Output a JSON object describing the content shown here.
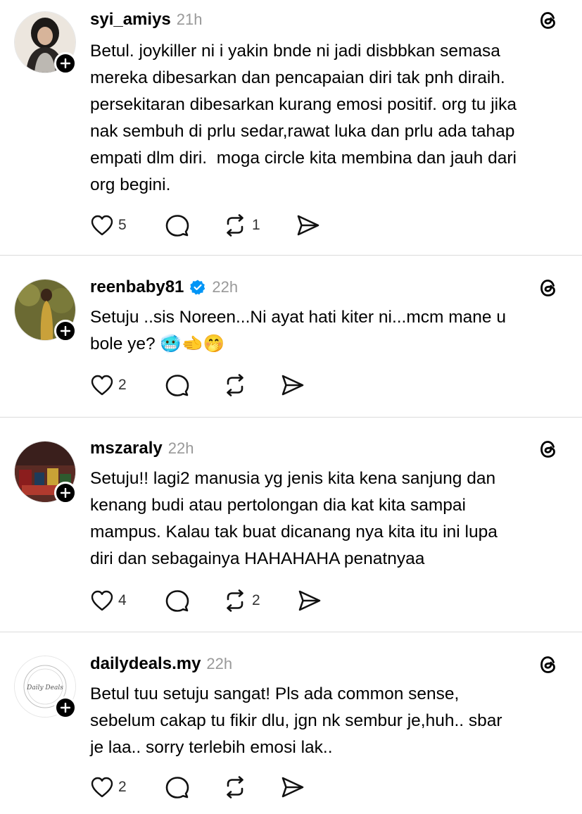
{
  "posts": [
    {
      "username": "syi_amiys",
      "time": "21h",
      "verified": false,
      "text": "Betul. joykiller ni i yakin bnde ni jadi disbbkan semasa\nmereka dibesarkan dan pencapaian diri tak pnh diraih.\npersekitaran dibesarkan kurang emosi positif. org tu jika\nnak sembuh di prlu sedar,rawat luka dan prlu ada tahap\nempati dlm diri.  moga circle kita membina dan jauh dari\norg begini.",
      "likes": "5",
      "reposts": "1"
    },
    {
      "username": "reenbaby81",
      "time": "22h",
      "verified": true,
      "text": "Setuju ..sis Noreen...Ni ayat hati kiter ni...mcm mane u\nbole ye? 🥶🫲🤭",
      "likes": "2",
      "reposts": ""
    },
    {
      "username": "mszaraly",
      "time": "22h",
      "verified": false,
      "text": "Setuju!! lagi2 manusia yg jenis kita kena sanjung dan\nkenang budi atau pertolongan dia kat kita sampai\nmampus. Kalau tak buat dicanang nya kita itu ini lupa\ndiri dan sebagainya HAHAHAHA penatnyaa",
      "likes": "4",
      "reposts": "2"
    },
    {
      "username": "dailydeals.my",
      "time": "22h",
      "verified": false,
      "text": "Betul tuu setuju sangat! Pls ada common sense,\nsebelum cakap tu fikir dlu, jgn nk sembur je,huh.. sbar\nje laa.. sorry terlebih emosi lak..",
      "likes": "2",
      "reposts": ""
    }
  ],
  "logo_text": "Daily Deals",
  "icons": {
    "like": "heart-icon",
    "reply": "reply-bubble-icon",
    "repost": "repost-icon",
    "share": "share-send-icon",
    "app": "threads-logo-icon",
    "follow": "plus-icon",
    "verified": "verified-badge-icon"
  },
  "colors": {
    "text": "#000000",
    "muted": "#999999",
    "verified": "#0095f6",
    "divider": "#dbdbdb"
  }
}
